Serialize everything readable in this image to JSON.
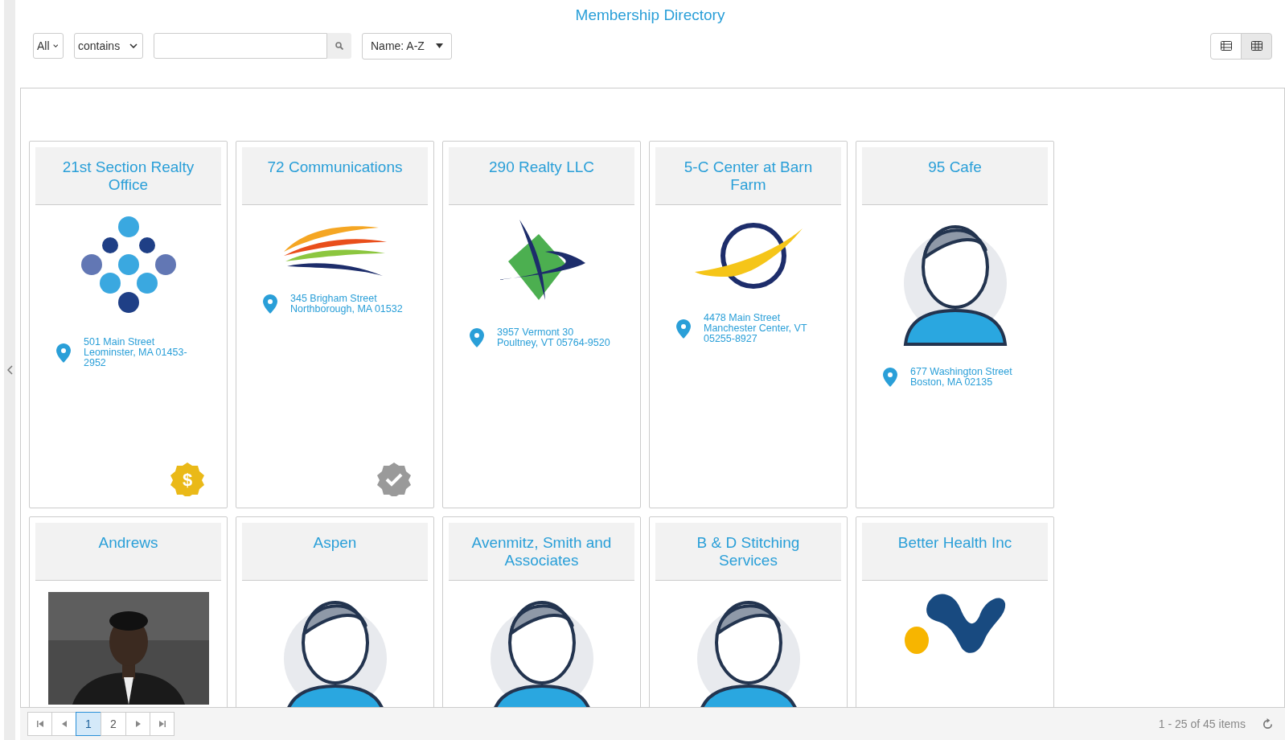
{
  "title": "Membership Directory",
  "filters": {
    "scope": "All",
    "match": "contains",
    "sort": "Name: A-Z"
  },
  "views": [
    {
      "kind": "list",
      "selected": false
    },
    {
      "kind": "grid",
      "selected": true
    }
  ],
  "members": [
    {
      "name": "21st Section Realty Office",
      "logo": {
        "kind": "dots"
      },
      "address": [
        "501 Main Street",
        "Leominster, MA 01453-",
        "2952"
      ],
      "badge": {
        "kind": "dollar",
        "symbol": "$"
      }
    },
    {
      "name": "72 Communications",
      "logo": {
        "kind": "swoosh"
      },
      "address": [
        "345 Brigham Street",
        "Northborough, MA 01532"
      ],
      "badge": {
        "kind": "check"
      }
    },
    {
      "name": "290 Realty LLC",
      "logo": {
        "kind": "diamond"
      },
      "address": [
        "3957 Vermont 30",
        "Poultney, VT 05764-9520"
      ]
    },
    {
      "name": "5-C Center at Barn Farm",
      "logo": {
        "kind": "ring"
      },
      "address": [
        "4478 Main Street",
        "Manchester Center, VT",
        "05255-8927"
      ]
    },
    {
      "name": "95 Cafe",
      "logo": {
        "kind": "avatar"
      },
      "address": [
        "677 Washington Street",
        "Boston, MA 02135"
      ]
    },
    {
      "name": "Andrews"
    },
    {
      "name": "Aspen",
      "logo": {
        "kind": "avatar"
      }
    },
    {
      "name": "Avenmitz, Smith and Associates",
      "logo": {
        "kind": "avatar"
      }
    },
    {
      "name": "B & D Stitching Services",
      "logo": {
        "kind": "avatar"
      }
    },
    {
      "name": "Better Health Inc",
      "logo": {
        "kind": "blob"
      }
    }
  ],
  "pager": {
    "pages": [
      {
        "label": "1",
        "selected": true
      },
      {
        "label": "2",
        "selected": false
      }
    ],
    "summary": "1 - 25 of 45 items"
  }
}
